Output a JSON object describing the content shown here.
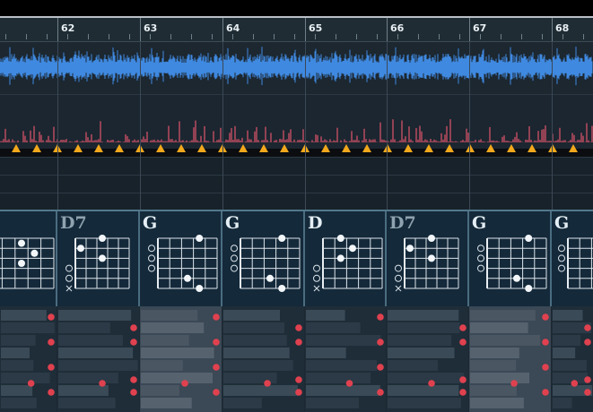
{
  "ruler": {
    "bars": [
      "62",
      "63",
      "64",
      "65",
      "66",
      "67",
      "68"
    ]
  },
  "chords": [
    {
      "name": "",
      "type": "major",
      "fretboard": "left-partial"
    },
    {
      "name": "D7",
      "type": "seventh"
    },
    {
      "name": "G",
      "type": "major"
    },
    {
      "name": "G",
      "type": "major"
    },
    {
      "name": "D",
      "type": "major"
    },
    {
      "name": "D7",
      "type": "seventh"
    },
    {
      "name": "G",
      "type": "major"
    },
    {
      "name": "G",
      "type": "major"
    }
  ],
  "colors": {
    "waveform": "#3f89e0",
    "peaks": "#e0566b",
    "markers": "#f2a81c",
    "note_dot": "#e0414f",
    "chord_border": "#52788c"
  },
  "icons": {
    "marker": "triangle-marker-icon",
    "open_string": "open-string-icon",
    "muted_string": "muted-string-icon"
  }
}
